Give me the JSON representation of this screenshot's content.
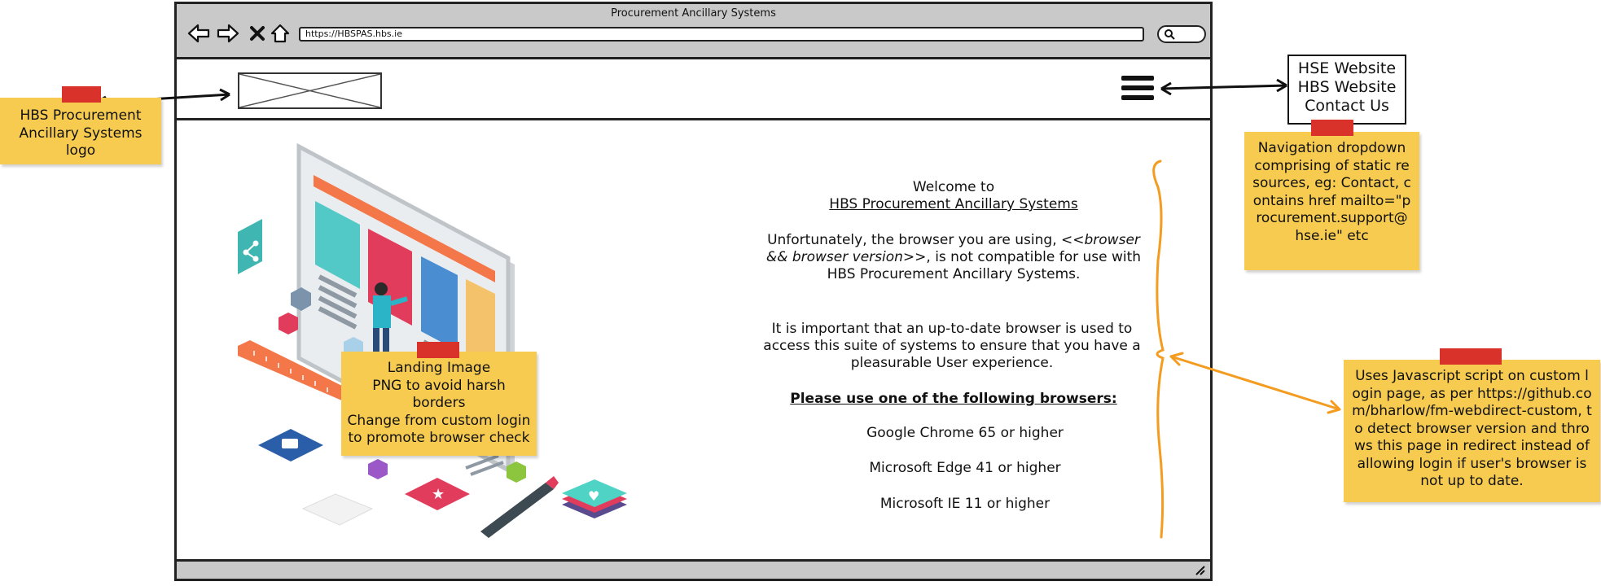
{
  "browser": {
    "window_title": "Procurement Ancillary Systems",
    "url": "https://HBSPAS.hbs.ie",
    "nav_icons": [
      "back-icon",
      "forward-icon",
      "stop-icon",
      "home-icon"
    ]
  },
  "main": {
    "welcome": "Welcome to",
    "app_name": "HBS Procurement Ancillary Systems",
    "incompat_prefix": "Unfortunately, the browser you are using, ",
    "incompat_placeholder": "<<browser && browser version>>",
    "incompat_suffix": ", is not compatible for use with HBS Procurement Ancillary Systems.",
    "importance": "It is important that an up-to-date browser is used to access this suite of systems to ensure that you have a pleasurable User experience.",
    "browsers_heading": "Please use one of the following browsers:",
    "browsers": [
      "Google Chrome 65 or higher",
      "Microsoft Edge 41 or higher",
      "Microsoft IE 11 or higher"
    ]
  },
  "annotations": {
    "logo_note": "HBS Procurement Ancillary Systems logo",
    "nav_note": "Navigation dropdown comprising of static resources, eg: Contact, contains href mailto=\"procurement.support@hse.ie\" etc",
    "image_note": [
      "Landing Image",
      "PNG to avoid harsh borders",
      "Change from custom login to promote browser check"
    ],
    "js_note": "Uses Javascript script on custom login page, as per https://github.com/bharlow/fm-webdirect-custom, to detect browser version and throws this page in redirect instead of allowing login if user's browser is not up to date.",
    "nav_items": [
      "HSE Website",
      "HBS Website",
      "Contact Us"
    ]
  },
  "colors": {
    "note_yellow": "#f6cb50",
    "tape_red": "#d9322b",
    "bracket_orange": "#f39c1f",
    "chrome_gray": "#c9c9c9"
  }
}
